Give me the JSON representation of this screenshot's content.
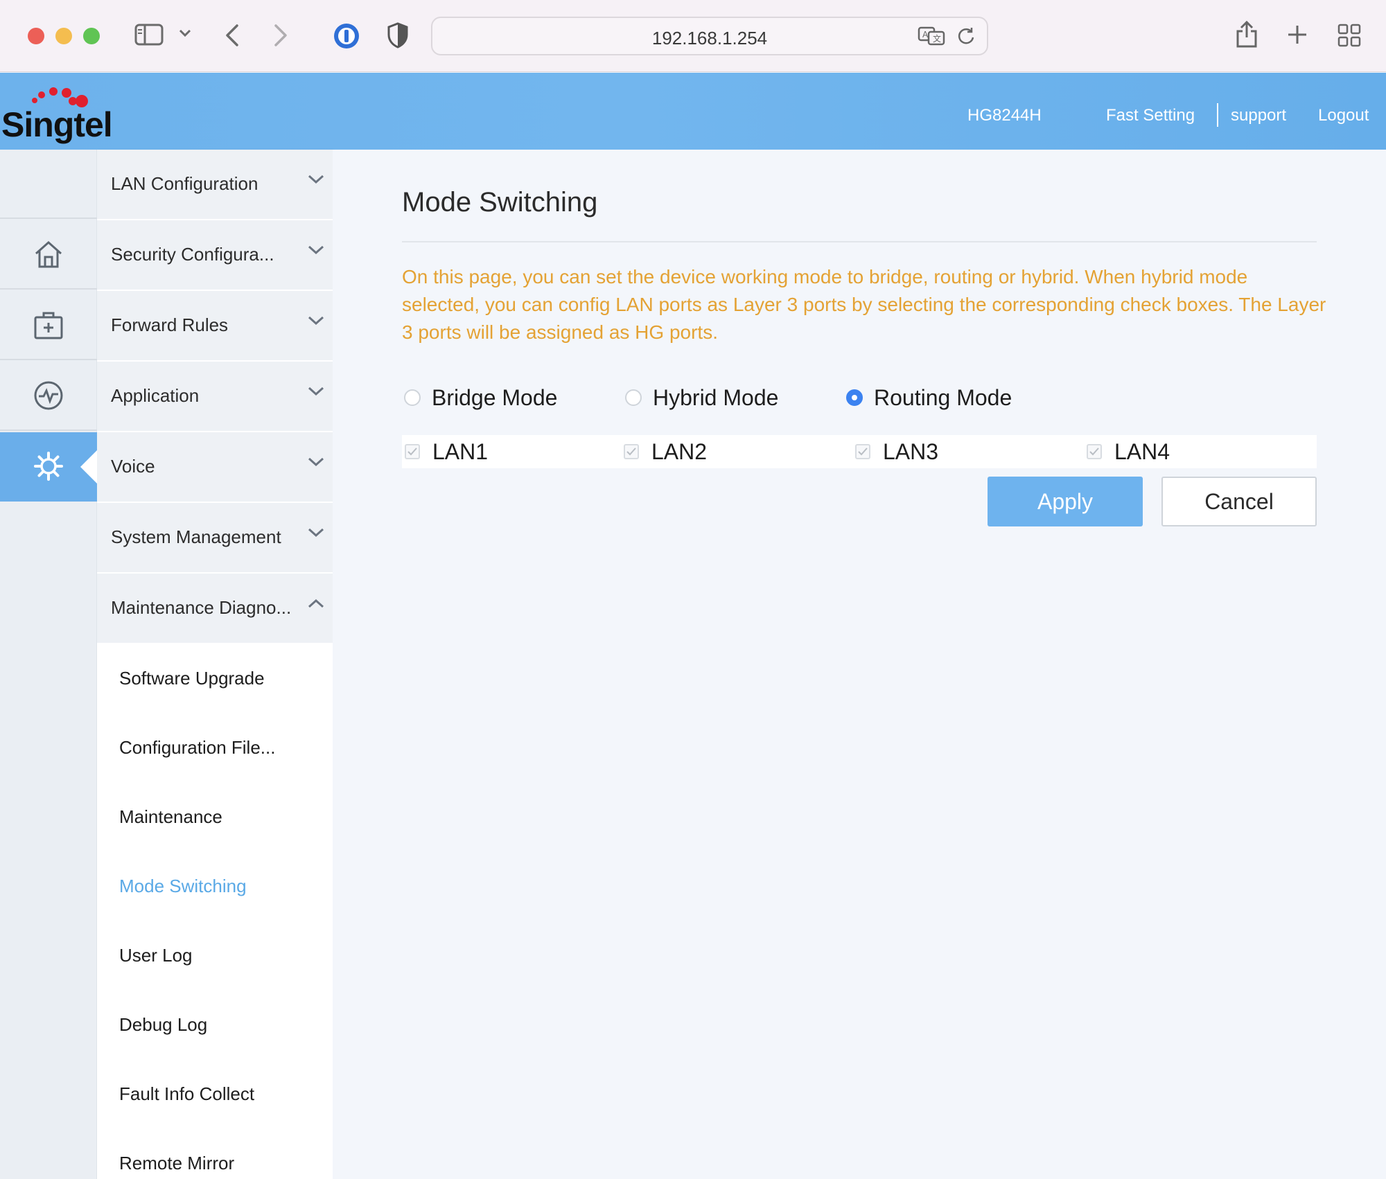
{
  "browser": {
    "url": "192.168.1.254"
  },
  "header": {
    "logo_text": "Singtel",
    "device_model": "HG8244H",
    "fast_setting": "Fast Setting",
    "support": "support",
    "logout": "Logout"
  },
  "rail": {
    "items": [
      {
        "icon": "home-icon"
      },
      {
        "icon": "medical-kit-icon"
      },
      {
        "icon": "heartbeat-icon"
      },
      {
        "icon": "gear-icon",
        "active": true
      }
    ]
  },
  "menu": {
    "groups": [
      {
        "label": "LAN Configuration",
        "expanded": false
      },
      {
        "label": "Security Configura...",
        "expanded": false
      },
      {
        "label": "Forward Rules",
        "expanded": false
      },
      {
        "label": "Application",
        "expanded": false
      },
      {
        "label": "Voice",
        "expanded": false
      },
      {
        "label": "System Management",
        "expanded": false
      },
      {
        "label": "Maintenance Diagno...",
        "expanded": true
      }
    ],
    "sub_items": [
      {
        "label": "Software Upgrade"
      },
      {
        "label": "Configuration File..."
      },
      {
        "label": "Maintenance"
      },
      {
        "label": "Mode Switching",
        "active": true
      },
      {
        "label": "User Log"
      },
      {
        "label": "Debug Log"
      },
      {
        "label": "Fault Info Collect"
      },
      {
        "label": "Remote Mirror"
      }
    ]
  },
  "main": {
    "title": "Mode Switching",
    "description": "On this page, you can set the device working mode to bridge, routing or hybrid. When hybrid mode selected, you can config LAN ports as Layer 3 ports by selecting the corresponding check boxes. The Layer 3 ports will be assigned as HG ports.",
    "modes": [
      {
        "label": "Bridge Mode",
        "selected": false
      },
      {
        "label": "Hybrid Mode",
        "selected": false
      },
      {
        "label": "Routing Mode",
        "selected": true
      }
    ],
    "lan_ports": [
      {
        "label": "LAN1",
        "checked": true,
        "disabled": true
      },
      {
        "label": "LAN2",
        "checked": true,
        "disabled": true
      },
      {
        "label": "LAN3",
        "checked": true,
        "disabled": true
      },
      {
        "label": "LAN4",
        "checked": true,
        "disabled": true
      }
    ],
    "apply_label": "Apply",
    "cancel_label": "Cancel"
  },
  "colors": {
    "accent": "#6eb3ee",
    "description_text": "#e4a234",
    "active_menu": "#5aa9e6",
    "radio_selected": "#3b82f0",
    "logo_dots": "#e0202e"
  }
}
